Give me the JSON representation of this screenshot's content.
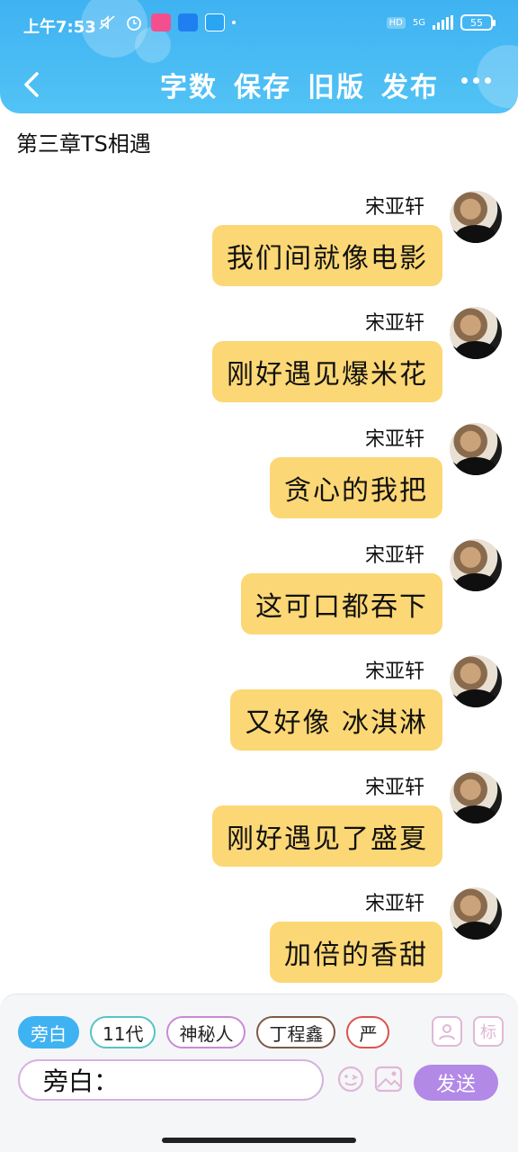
{
  "status_bar": {
    "time": "上午7:53",
    "hd": "HD",
    "network": "5G",
    "battery": "55"
  },
  "toolbar": {
    "word_count": "字数",
    "save": "保存",
    "old_version": "旧版",
    "publish": "发布"
  },
  "chapter": {
    "title": "第三章TS相遇"
  },
  "messages": [
    {
      "sender": "宋亚轩",
      "text": "我们间就像电影"
    },
    {
      "sender": "宋亚轩",
      "text": "刚好遇见爆米花"
    },
    {
      "sender": "宋亚轩",
      "text": "贪心的我把"
    },
    {
      "sender": "宋亚轩",
      "text": "这可口都吞下"
    },
    {
      "sender": "宋亚轩",
      "text": "又好像 冰淇淋"
    },
    {
      "sender": "宋亚轩",
      "text": "刚好遇见了盛夏"
    },
    {
      "sender": "宋亚轩",
      "text": "加倍的香甜"
    }
  ],
  "roles": [
    "旁白",
    "11代",
    "神秘人",
    "丁程鑫",
    "严"
  ],
  "composer": {
    "input_text": "旁白：",
    "send_label": "发送",
    "tag_label": "标"
  },
  "colors": {
    "header": "#3fb2f2",
    "bubble": "#fcd775",
    "send": "#b289e6"
  }
}
